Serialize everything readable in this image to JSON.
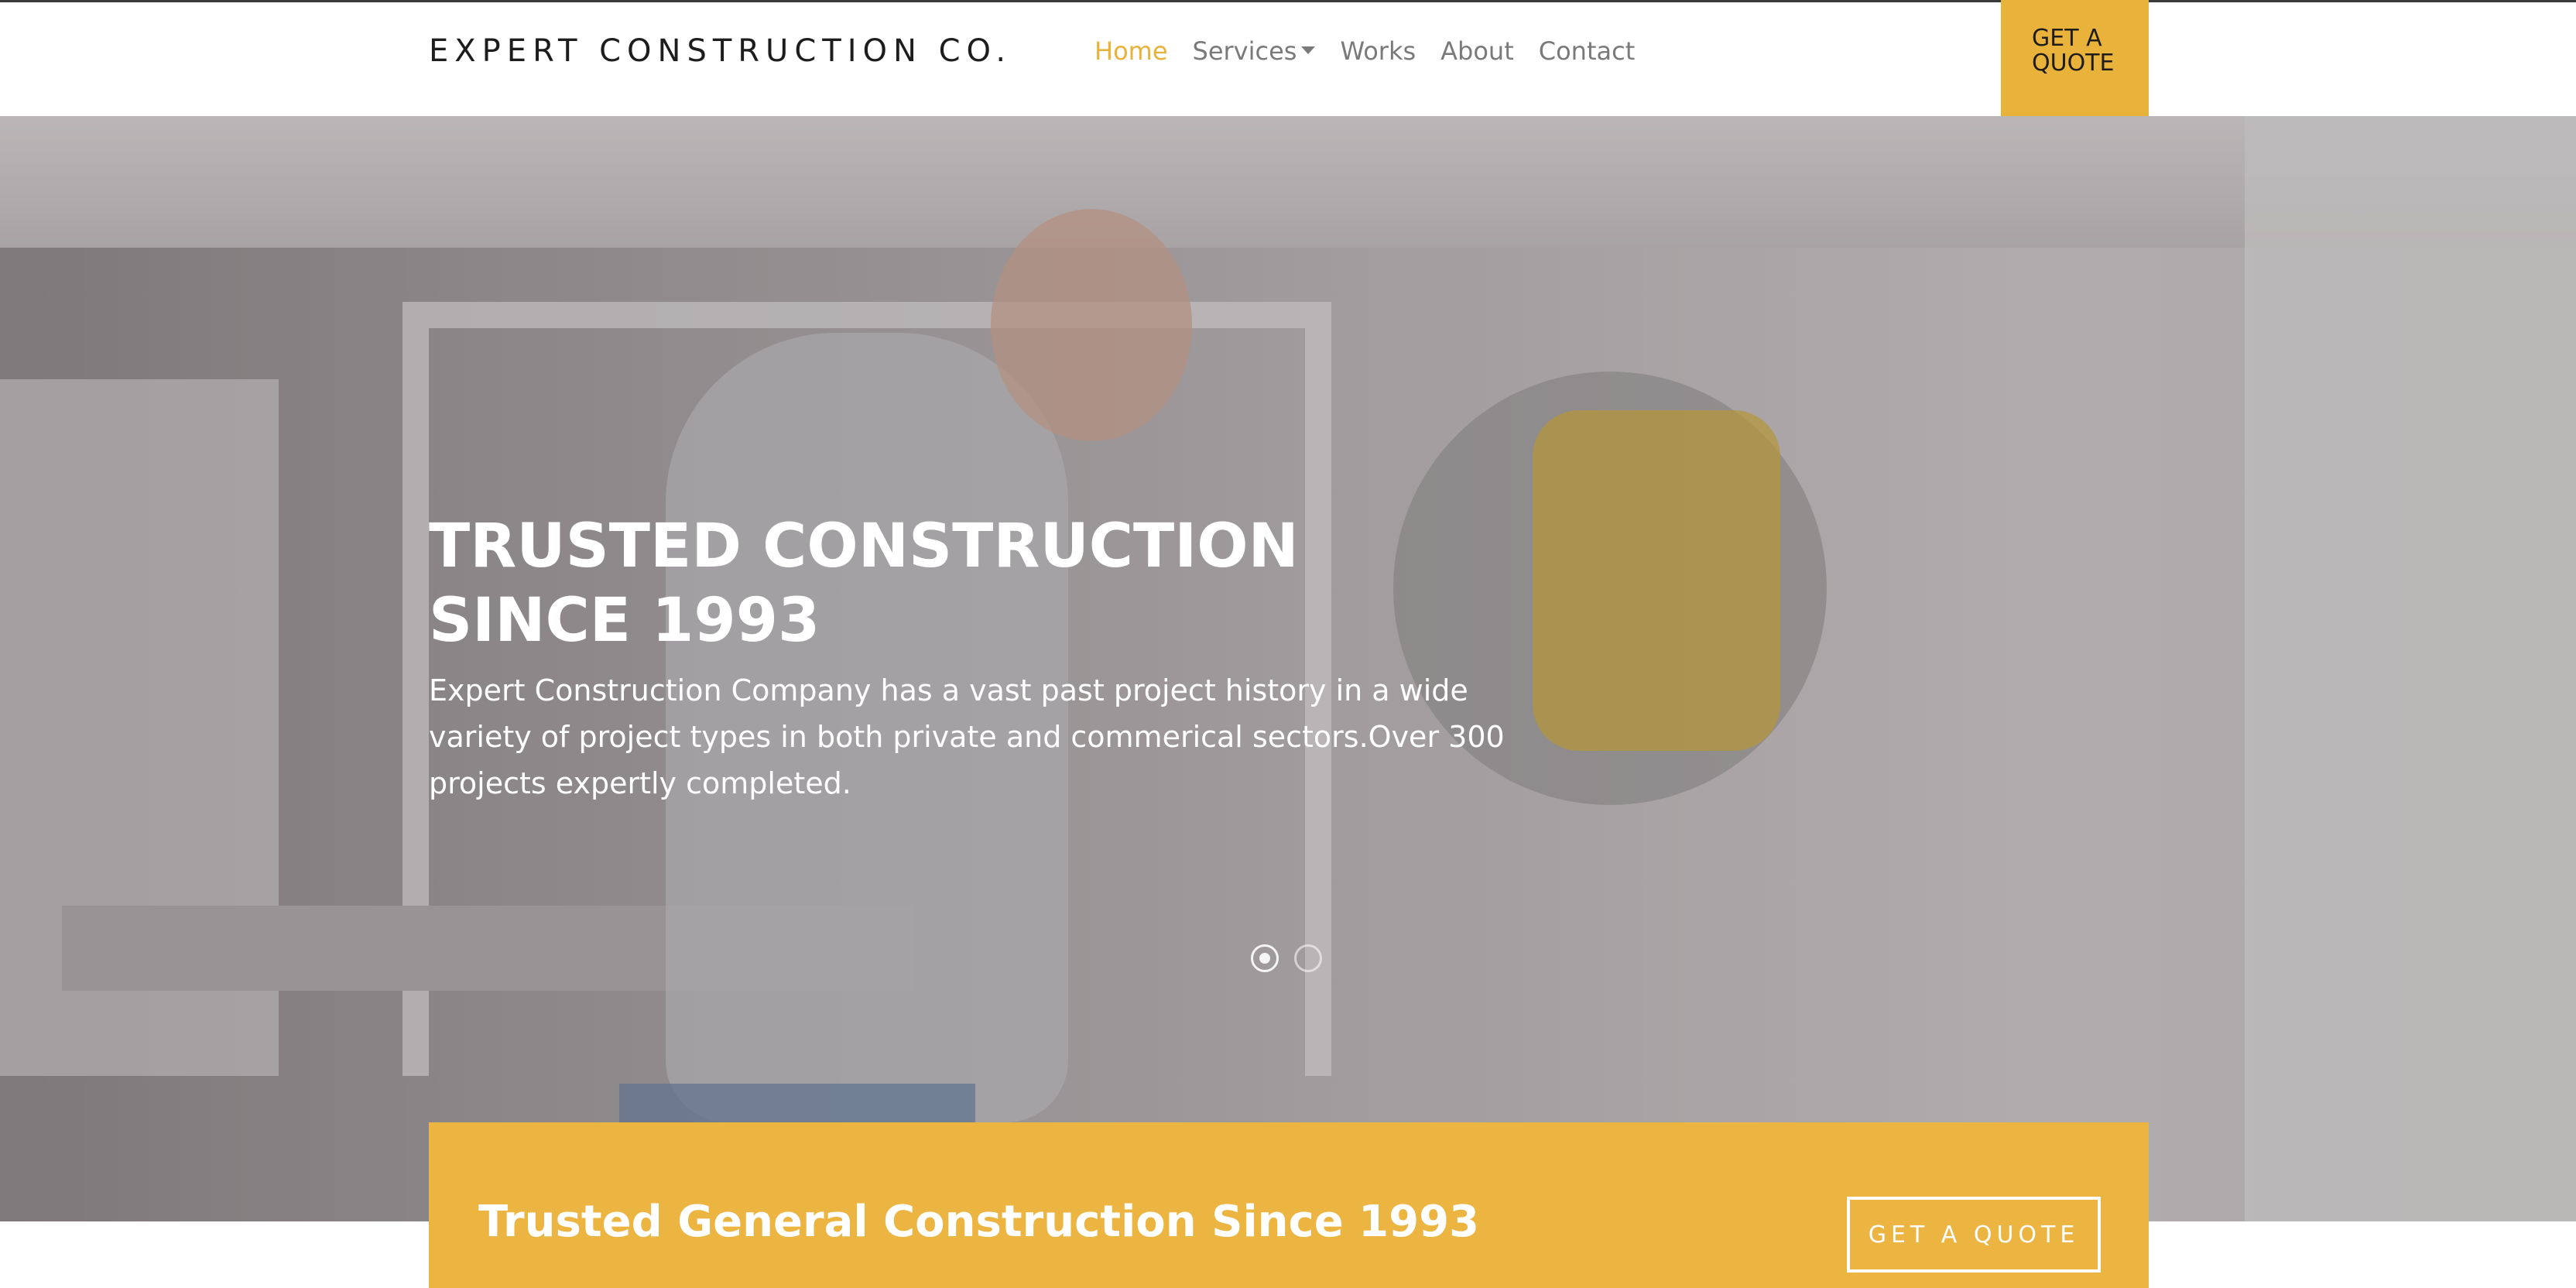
{
  "brand": {
    "name": "EXPERT CONSTRUCTION CO."
  },
  "nav": {
    "items": [
      {
        "label": "Home",
        "active": true
      },
      {
        "label": "Services",
        "dropdown": true
      },
      {
        "label": "Works"
      },
      {
        "label": "About"
      },
      {
        "label": "Contact"
      }
    ],
    "quote_button": "GET A QUOTE"
  },
  "hero": {
    "title": "TRUSTED CONSTRUCTION SINCE 1993",
    "text": "Expert Construction Company has a vast past project history in a wide variety of project types in both private and commerical sectors.Over 300 projects expertly completed.",
    "slides_total": 2,
    "active_slide": 1
  },
  "banner": {
    "title": "Trusted General Construction Since 1993",
    "button": "GET A QUOTE"
  },
  "colors": {
    "accent": "#e9b23a",
    "nav_text": "#7a7a7a",
    "brand_text": "#1d1d1d"
  }
}
